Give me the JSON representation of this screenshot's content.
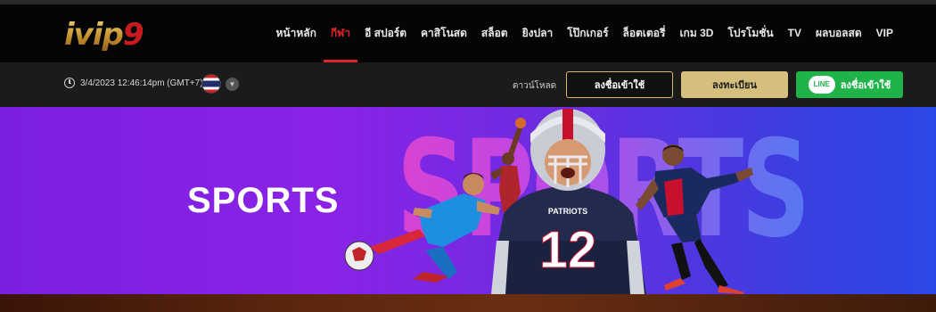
{
  "header": {
    "logo": {
      "main": "ivip",
      "accent": "9"
    },
    "nav": [
      {
        "label": "หน้าหลัก",
        "active": false
      },
      {
        "label": "กีฬา",
        "active": true
      },
      {
        "label": "อี สปอร์ต",
        "active": false
      },
      {
        "label": "คาสิโนสด",
        "active": false
      },
      {
        "label": "สล็อต",
        "active": false
      },
      {
        "label": "ยิงปลา",
        "active": false
      },
      {
        "label": "โป๊กเกอร์",
        "active": false
      },
      {
        "label": "ล็อตเตอรี่",
        "active": false
      },
      {
        "label": "เกม 3D",
        "active": false
      },
      {
        "label": "โปรโมชั่น",
        "active": false
      },
      {
        "label": "TV",
        "active": false
      },
      {
        "label": "ผลบอลสด",
        "active": false
      },
      {
        "label": "VIP",
        "active": false
      }
    ]
  },
  "subbar": {
    "datetime": "3/4/2023 12:46:14pm (GMT+7)",
    "flag": "thailand-flag-icon",
    "download_label": "ดาวน์โหลด",
    "login_label": "ลงชื่อเข้าใช้",
    "register_label": "ลงทะเบียน",
    "line_badge": "LINE",
    "line_login_label": "ลงชื่อเข้าใช้"
  },
  "banner": {
    "title": "SPORTS",
    "background_text": "SPORTS",
    "jersey_number": "12",
    "jersey_brand": "PATRIOTS"
  },
  "colors": {
    "accent_red": "#e0242b",
    "gold": "#d6bf7c",
    "line_green": "#1fb34a",
    "banner_purple": "#8a23e6",
    "banner_blue": "#2b48e6"
  }
}
